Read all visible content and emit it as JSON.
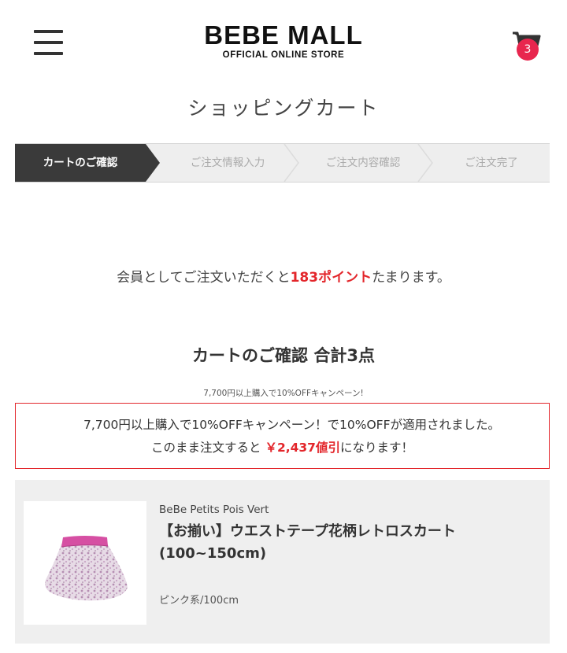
{
  "header": {
    "logo_main": "BEBE MALL",
    "logo_sub": "OFFICIAL ONLINE STORE",
    "cart_count": "3"
  },
  "page_title": "ショッピングカート",
  "steps": [
    {
      "label": "カートのご確認",
      "active": true
    },
    {
      "label": "ご注文情報入力",
      "active": false
    },
    {
      "label": "ご注文内容確認",
      "active": false
    },
    {
      "label": "ご注文完了",
      "active": false
    }
  ],
  "points": {
    "prefix": "会員としてご注文いただくと",
    "highlight": "183ポイント",
    "suffix": "たまります。"
  },
  "cart_title": "カートのご確認 合計3点",
  "campaign": {
    "note": "7,700円以上購入で10%OFFキャンペーン!",
    "line1": "7,700円以上購入で10%OFFキャンペーン！で10%OFFが適用されました。",
    "line2_prefix": "このまま注文すると ",
    "line2_highlight": "￥2,437値引",
    "line2_suffix": "になります！"
  },
  "item": {
    "brand": "BeBe Petits Pois Vert",
    "name": "【お揃い】ウエストテープ花柄レトロスカート(100~150cm)",
    "variant": "ピンク系/100cm",
    "image_alt": "skirt-image"
  },
  "colors": {
    "accent_red": "#e3262b",
    "badge_pink": "#e8264e",
    "step_active": "#3a3a3a"
  }
}
